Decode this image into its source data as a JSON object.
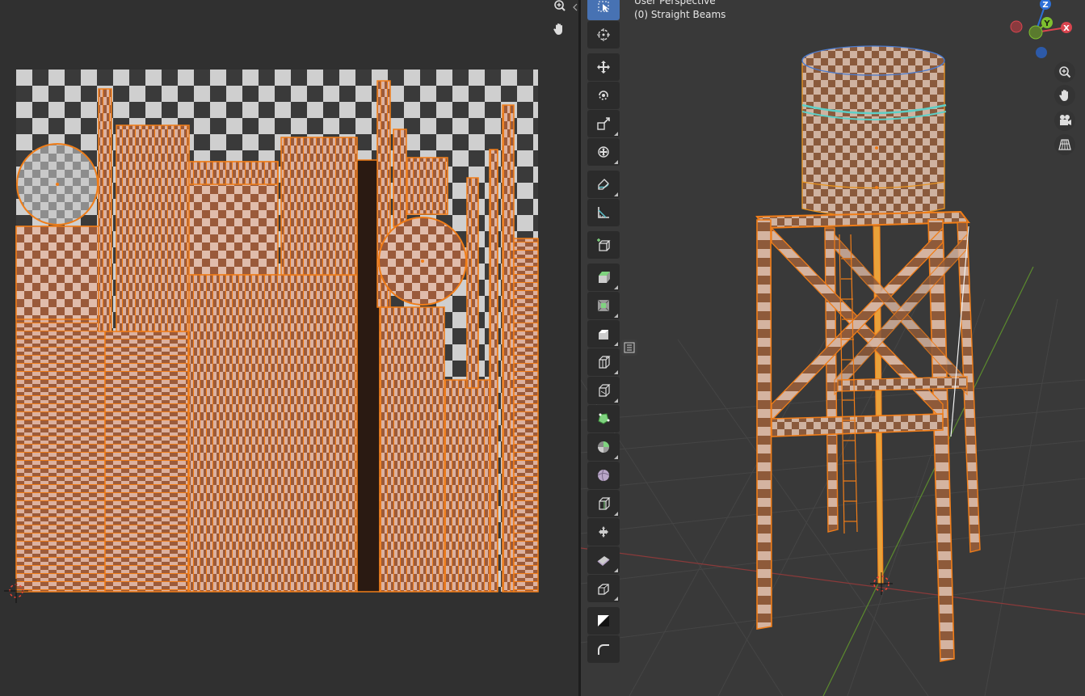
{
  "viewport": {
    "mode_label": "User Perspective",
    "object_label": "(0) Straight Beams"
  },
  "uv_editor": {
    "nav": [
      {
        "name": "zoom-icon"
      },
      {
        "name": "pan-hand-icon"
      }
    ]
  },
  "toolbar": {
    "tools": [
      {
        "name": "select-box-tool",
        "icon": "select-box-icon",
        "active": true
      },
      {
        "name": "cursor-tool",
        "icon": "cursor-icon"
      },
      {
        "name": "move-tool",
        "icon": "move-icon"
      },
      {
        "name": "rotate-tool",
        "icon": "rotate-icon"
      },
      {
        "name": "scale-tool",
        "icon": "scale-icon"
      },
      {
        "name": "transform-tool",
        "icon": "transform-icon"
      },
      {
        "name": "annotate-tool",
        "icon": "annotate-icon"
      },
      {
        "name": "measure-tool",
        "icon": "measure-icon"
      },
      {
        "name": "add-cube-tool",
        "icon": "add-cube-icon"
      },
      {
        "name": "extrude-region-tool",
        "icon": "extrude-icon"
      },
      {
        "name": "inset-faces-tool",
        "icon": "inset-icon"
      },
      {
        "name": "bevel-tool",
        "icon": "bevel-icon"
      },
      {
        "name": "loop-cut-tool",
        "icon": "loop-cut-icon"
      },
      {
        "name": "knife-tool",
        "icon": "knife-icon"
      },
      {
        "name": "poly-build-tool",
        "icon": "poly-build-icon"
      },
      {
        "name": "spin-tool",
        "icon": "spin-icon"
      },
      {
        "name": "smooth-tool",
        "icon": "smooth-icon"
      },
      {
        "name": "edge-slide-tool",
        "icon": "edge-slide-icon"
      },
      {
        "name": "shrink-fatten-tool",
        "icon": "shrink-fatten-icon"
      },
      {
        "name": "shear-tool",
        "icon": "shear-icon"
      },
      {
        "name": "rip-region-tool",
        "icon": "rip-icon"
      },
      {
        "name": "uv-unwrap-tool",
        "icon": "uv-icon"
      },
      {
        "name": "curve-tool",
        "icon": "curve-icon"
      }
    ]
  },
  "gizmo": {
    "axes": [
      {
        "label": "Z",
        "color": "#2d6fd6"
      },
      {
        "label": "Y",
        "color": "#7ec02f"
      },
      {
        "label": "X",
        "color": "#d9454f"
      }
    ]
  },
  "viewport_nav": [
    {
      "name": "zoom-icon"
    },
    {
      "name": "pan-hand-icon"
    },
    {
      "name": "camera-icon"
    },
    {
      "name": "perspective-grid-icon"
    }
  ],
  "colors": {
    "selection": "#f07d18",
    "edit_wire": "#e9941f",
    "background": "#303030",
    "viewport_bg": "#393939",
    "active_tool": "#4772b3",
    "checker_brown": "#9a5a3a",
    "checker_pink": "#d9b4a3"
  }
}
